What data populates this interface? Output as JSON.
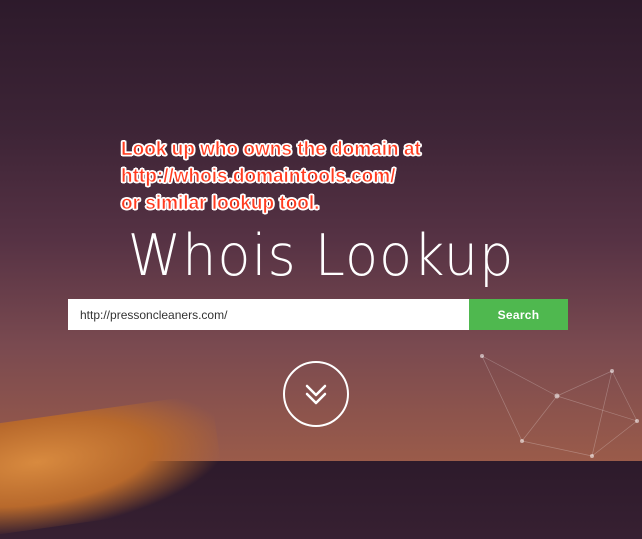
{
  "annotation": {
    "lines": [
      "Look up who owns the domain at",
      "http://whois.domaintools.com/",
      "or similar lookup tool."
    ],
    "color": "#ff3b1f"
  },
  "page": {
    "title": "Whois Lookup"
  },
  "search": {
    "value": "http://pressoncleaners.com/",
    "button_label": "Search",
    "button_color": "#4fb84f"
  },
  "scroll_down": {
    "icon": "double-chevron-down-icon"
  }
}
